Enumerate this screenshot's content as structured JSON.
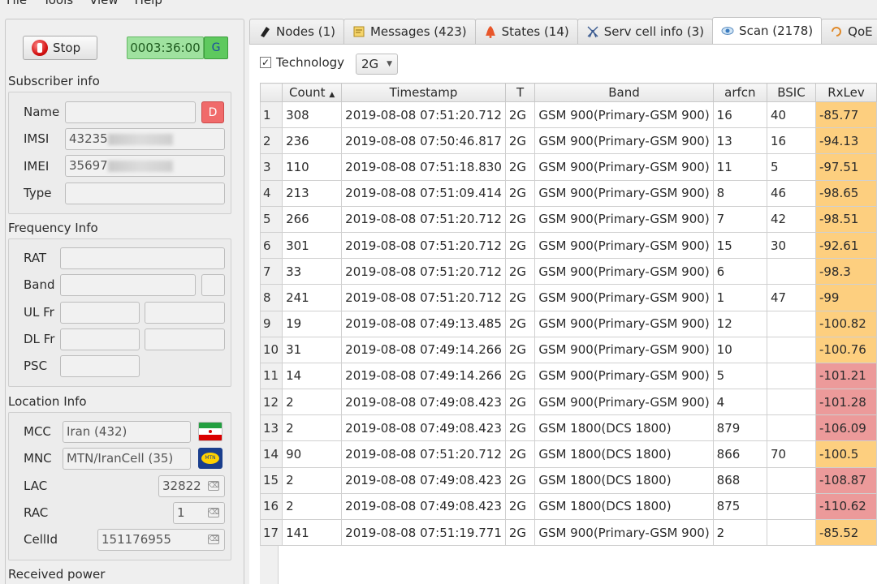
{
  "menu": [
    "File",
    "Tools",
    "View",
    "Help"
  ],
  "controls": {
    "stop_label": "Stop",
    "timer": "0003:36:00",
    "g_label": "G"
  },
  "subscriber": {
    "title": "Subscriber info",
    "name_label": "Name",
    "name_value": "",
    "d_label": "D",
    "imsi_label": "IMSI",
    "imsi_value": "43235",
    "imei_label": "IMEI",
    "imei_value": "35697",
    "type_label": "Type",
    "type_value": ""
  },
  "frequency": {
    "title": "Frequency Info",
    "rat_label": "RAT",
    "band_label": "Band",
    "ulfr_label": "UL Fr",
    "dlfr_label": "DL Fr",
    "psc_label": "PSC"
  },
  "location": {
    "title": "Location Info",
    "mcc_label": "MCC",
    "mcc_value": "Iran (432)",
    "mnc_label": "MNC",
    "mnc_value": "MTN/IranCell (35)",
    "lac_label": "LAC",
    "lac_value": "32822",
    "rac_label": "RAC",
    "rac_value": "1",
    "cellid_label": "CellId",
    "cellid_value": "151176955"
  },
  "received_power": {
    "title": "Received power"
  },
  "tabs": [
    {
      "label": "Nodes (1)",
      "icon": "nodes-icon"
    },
    {
      "label": "Messages (423)",
      "icon": "messages-icon"
    },
    {
      "label": "States (14)",
      "icon": "states-icon"
    },
    {
      "label": "Serv cell info (3)",
      "icon": "serv-cell-icon"
    },
    {
      "label": "Scan (2178)",
      "icon": "scan-icon",
      "active": true
    },
    {
      "label": "QoE (",
      "icon": "qoe-icon"
    }
  ],
  "filter": {
    "checked": true,
    "technology_label": "Technology",
    "technology_value": "2G"
  },
  "table": {
    "columns": [
      "Count",
      "Timestamp",
      "T",
      "Band",
      "arfcn",
      "BSIC",
      "RxLev"
    ],
    "sort_indicator": "▲",
    "rows": [
      {
        "n": "1",
        "count": "308",
        "ts": "2019-08-08 07:51:20.712",
        "t": "2G",
        "band": "GSM 900(Primary-GSM 900)",
        "arfcn": "16",
        "bsic": "40",
        "rxlev": "-85.77",
        "level": "orange"
      },
      {
        "n": "2",
        "count": "236",
        "ts": "2019-08-08 07:50:46.817",
        "t": "2G",
        "band": "GSM 900(Primary-GSM 900)",
        "arfcn": "13",
        "bsic": "16",
        "rxlev": "-94.13",
        "level": "orange"
      },
      {
        "n": "3",
        "count": "110",
        "ts": "2019-08-08 07:51:18.830",
        "t": "2G",
        "band": "GSM 900(Primary-GSM 900)",
        "arfcn": "11",
        "bsic": "5",
        "rxlev": "-97.51",
        "level": "orange"
      },
      {
        "n": "4",
        "count": "213",
        "ts": "2019-08-08 07:51:09.414",
        "t": "2G",
        "band": "GSM 900(Primary-GSM 900)",
        "arfcn": "8",
        "bsic": "46",
        "rxlev": "-98.65",
        "level": "orange"
      },
      {
        "n": "5",
        "count": "266",
        "ts": "2019-08-08 07:51:20.712",
        "t": "2G",
        "band": "GSM 900(Primary-GSM 900)",
        "arfcn": "7",
        "bsic": "42",
        "rxlev": "-98.51",
        "level": "orange"
      },
      {
        "n": "6",
        "count": "301",
        "ts": "2019-08-08 07:51:20.712",
        "t": "2G",
        "band": "GSM 900(Primary-GSM 900)",
        "arfcn": "15",
        "bsic": "30",
        "rxlev": "-92.61",
        "level": "orange"
      },
      {
        "n": "7",
        "count": "33",
        "ts": "2019-08-08 07:51:20.712",
        "t": "2G",
        "band": "GSM 900(Primary-GSM 900)",
        "arfcn": "6",
        "bsic": "",
        "rxlev": "-98.3",
        "level": "orange"
      },
      {
        "n": "8",
        "count": "241",
        "ts": "2019-08-08 07:51:20.712",
        "t": "2G",
        "band": "GSM 900(Primary-GSM 900)",
        "arfcn": "1",
        "bsic": "47",
        "rxlev": "-99",
        "level": "orange"
      },
      {
        "n": "9",
        "count": "19",
        "ts": "2019-08-08 07:49:13.485",
        "t": "2G",
        "band": "GSM 900(Primary-GSM 900)",
        "arfcn": "12",
        "bsic": "",
        "rxlev": "-100.82",
        "level": "orange"
      },
      {
        "n": "10",
        "count": "31",
        "ts": "2019-08-08 07:49:14.266",
        "t": "2G",
        "band": "GSM 900(Primary-GSM 900)",
        "arfcn": "10",
        "bsic": "",
        "rxlev": "-100.76",
        "level": "orange"
      },
      {
        "n": "11",
        "count": "14",
        "ts": "2019-08-08 07:49:14.266",
        "t": "2G",
        "band": "GSM 900(Primary-GSM 900)",
        "arfcn": "5",
        "bsic": "",
        "rxlev": "-101.21",
        "level": "red"
      },
      {
        "n": "12",
        "count": "2",
        "ts": "2019-08-08 07:49:08.423",
        "t": "2G",
        "band": "GSM 900(Primary-GSM 900)",
        "arfcn": "4",
        "bsic": "",
        "rxlev": "-101.28",
        "level": "red"
      },
      {
        "n": "13",
        "count": "2",
        "ts": "2019-08-08 07:49:08.423",
        "t": "2G",
        "band": "GSM 1800(DCS 1800)",
        "arfcn": "879",
        "bsic": "",
        "rxlev": "-106.09",
        "level": "red"
      },
      {
        "n": "14",
        "count": "90",
        "ts": "2019-08-08 07:51:20.712",
        "t": "2G",
        "band": "GSM 1800(DCS 1800)",
        "arfcn": "866",
        "bsic": "70",
        "rxlev": "-100.5",
        "level": "orange"
      },
      {
        "n": "15",
        "count": "2",
        "ts": "2019-08-08 07:49:08.423",
        "t": "2G",
        "band": "GSM 1800(DCS 1800)",
        "arfcn": "868",
        "bsic": "",
        "rxlev": "-108.87",
        "level": "red"
      },
      {
        "n": "16",
        "count": "2",
        "ts": "2019-08-08 07:49:08.423",
        "t": "2G",
        "band": "GSM 1800(DCS 1800)",
        "arfcn": "875",
        "bsic": "",
        "rxlev": "-110.62",
        "level": "red"
      },
      {
        "n": "17",
        "count": "141",
        "ts": "2019-08-08 07:51:19.771",
        "t": "2G",
        "band": "GSM 900(Primary-GSM 900)",
        "arfcn": "2",
        "bsic": "",
        "rxlev": "-85.52",
        "level": "orange"
      }
    ]
  },
  "colors": {
    "rx_orange": "#fdcf7f",
    "rx_red": "#ec9a9a",
    "timer_bg": "#9fe29f",
    "d_button": "#f06a6a"
  }
}
